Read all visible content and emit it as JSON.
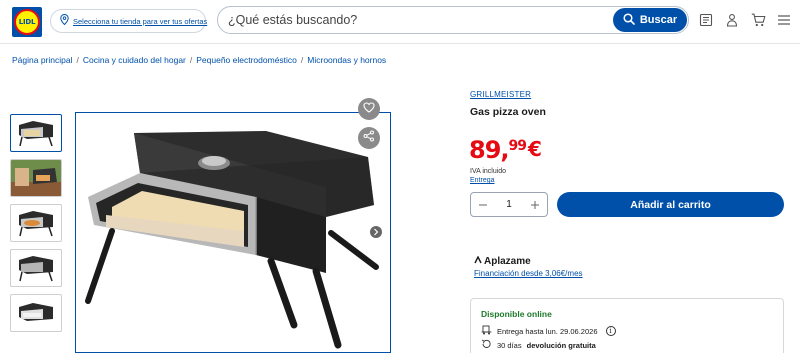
{
  "header": {
    "logo_text": "LIDL",
    "store_link": "Selecciona tu tienda para ver tus ofertas",
    "search_placeholder": "¿Qué estás buscando?",
    "search_button": "Buscar",
    "icons": [
      "catalog-icon",
      "user-icon",
      "cart-icon",
      "menu-icon"
    ]
  },
  "breadcrumb": [
    "Página principal",
    "Cocina y cuidado del hogar",
    "Pequeño electrodoméstico",
    "Microondas y hornos"
  ],
  "breadcrumb_separator": "/",
  "product": {
    "brand": "GRILLMEISTER",
    "title": "Gas pizza oven",
    "price_int": "89,",
    "price_dec": "99",
    "currency": "€",
    "vat": "IVA incluido",
    "delivery_link": "Entrega",
    "quantity": "1",
    "add_to_cart": "Añadir al carrito"
  },
  "financing": {
    "provider": "Aplazame",
    "link": "Financiación desde 3,06€/mes"
  },
  "availability": {
    "title": "Disponible online",
    "delivery_text": "Entrega hasta lun. 29.06.2026",
    "return_prefix": "30 días",
    "return_bold": "devolución gratuita"
  },
  "colors": {
    "brand_blue": "#0050aa",
    "price_red": "#e60a14",
    "available_green": "#1d7a2a"
  }
}
